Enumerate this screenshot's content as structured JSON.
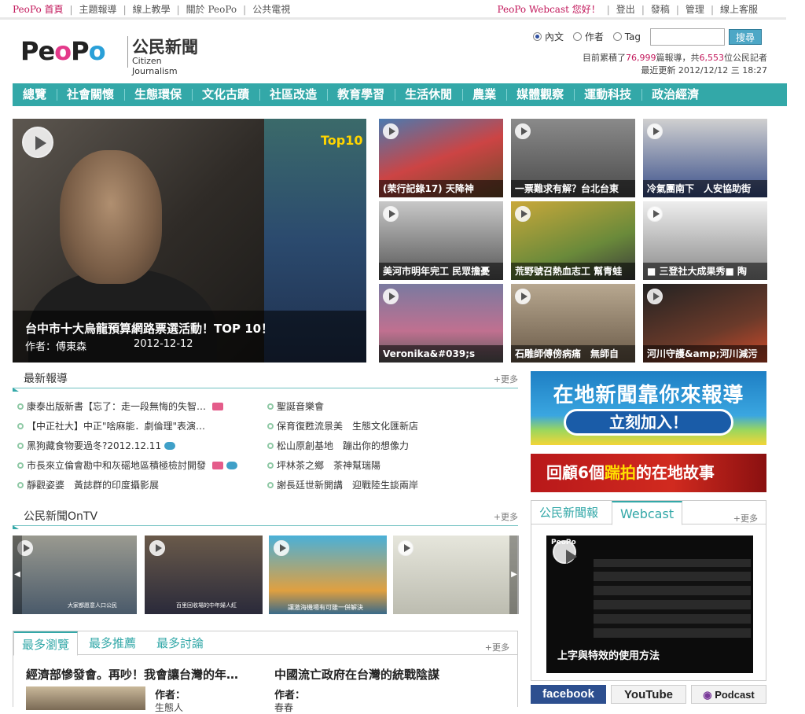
{
  "topbar": {
    "left_links": [
      "PeoPo 首頁",
      "主題報導",
      "線上教學",
      "關於 PeoPo",
      "公共電視"
    ],
    "greeting": "PeoPo Webcast 您好！",
    "right_links": [
      "登出",
      "發稿",
      "管理",
      "線上客服"
    ]
  },
  "logo": {
    "brand": "PeoPo",
    "cn": "公民新聞",
    "en": "Citizen Journalism"
  },
  "search": {
    "options": [
      "內文",
      "作者",
      "Tag"
    ],
    "selected": "內文",
    "value": "",
    "button": "搜尋"
  },
  "stats": {
    "prefix": "目前累積了",
    "reports": "76,999",
    "mid": "篇報導，共",
    "reporters": "6,553",
    "suffix": "位公民記者",
    "updated": "最近更新 2012/12/12 三 18:27"
  },
  "nav": [
    "總覽",
    "社會關懷",
    "生態環保",
    "文化古蹟",
    "社區改造",
    "教育學習",
    "生活休閒",
    "農業",
    "媒體觀察",
    "運動科技",
    "政治經濟"
  ],
  "hero": {
    "title": "台中市十大烏龍預算網路票選活動！TOP 10！",
    "author": "作者：傅東森",
    "date": "2012-12-12",
    "sign_text": "Top10"
  },
  "thumbs": [
    {
      "caption": "(茉行記錄17) 天降神"
    },
    {
      "caption": "一票難求有解？台北台東"
    },
    {
      "caption": "冷氣團南下　人安協助街"
    },
    {
      "caption": "美河市明年完工 民眾擔憂"
    },
    {
      "caption": "荒野號召熱血志工 幫青蛙"
    },
    {
      "caption": "■ 三登社大成果秀■ 陶"
    },
    {
      "caption": "Veronika&#039;s"
    },
    {
      "caption": "石雕師傅傍病痛　無師自"
    },
    {
      "caption": "河川守護&amp;河川減污"
    }
  ],
  "latest": {
    "title": "最新報導",
    "more": "+更多",
    "left": [
      {
        "text": "康泰出版新書【忘了：走一段無悔的失智…",
        "cam": true,
        "vid": false
      },
      {
        "text": "【中正社大】中正\"啥麻能．劇倫理\"表演…",
        "cam": false,
        "vid": false
      },
      {
        "text": "黑狗藏食物要過冬?2012.12.11",
        "cam": false,
        "vid": true
      },
      {
        "text": "市長來立倫會勘中和灰磘地區積極檢討開發",
        "cam": true,
        "vid": true
      },
      {
        "text": "靜觀姿婆　黃誌群的印度攝影展",
        "cam": false,
        "vid": false
      }
    ],
    "right": [
      {
        "text": "聖誕音樂會"
      },
      {
        "text": "保育復甦流景美　生態文化匯新店"
      },
      {
        "text": "松山原創基地　蹦出你的想像力"
      },
      {
        "text": "坪林茶之鄉　茶神幫瑞陽"
      },
      {
        "text": "謝長廷世新開講　迎戰陸生談兩岸"
      }
    ]
  },
  "banner1": {
    "line1": "在地新聞靠你來報導",
    "button": "立刻加入！"
  },
  "banner2": {
    "pre": "回顧6個",
    "highlight": "踹拍",
    "post": "的在地故事"
  },
  "ontv": {
    "title": "公民新聞OnTV",
    "more": "+更多",
    "thumb_text": [
      "大家都愿意人口公民",
      "百里回收場的中年婦人紅",
      "讓激海機場有可雖一併解決",
      ""
    ]
  },
  "bottom_tabs": {
    "tabs": [
      "最多瀏覽",
      "最多推薦",
      "最多討論"
    ],
    "active": "最多瀏覽",
    "more": "+更多",
    "items": [
      {
        "headline": "經濟部慘發會。再吵！我會讓台灣的年…",
        "author_label": "作者：",
        "author": "生態人"
      },
      {
        "headline": "中國流亡政府在台灣的統戰陰謀",
        "author_label": "作者：",
        "author": "春春"
      }
    ]
  },
  "right_box": {
    "tabs": [
      "公民新聞報",
      "Webcast"
    ],
    "active": "Webcast",
    "more": "+更多",
    "video_caption": "上字與特效的使用方法",
    "badge": "PeoPo"
  },
  "social": [
    "facebook",
    "YouTube",
    "Podcast"
  ],
  "colors": {
    "accent": "#33a8a8",
    "pink": "#c2185b",
    "link_blue": "#2f4fa0"
  }
}
